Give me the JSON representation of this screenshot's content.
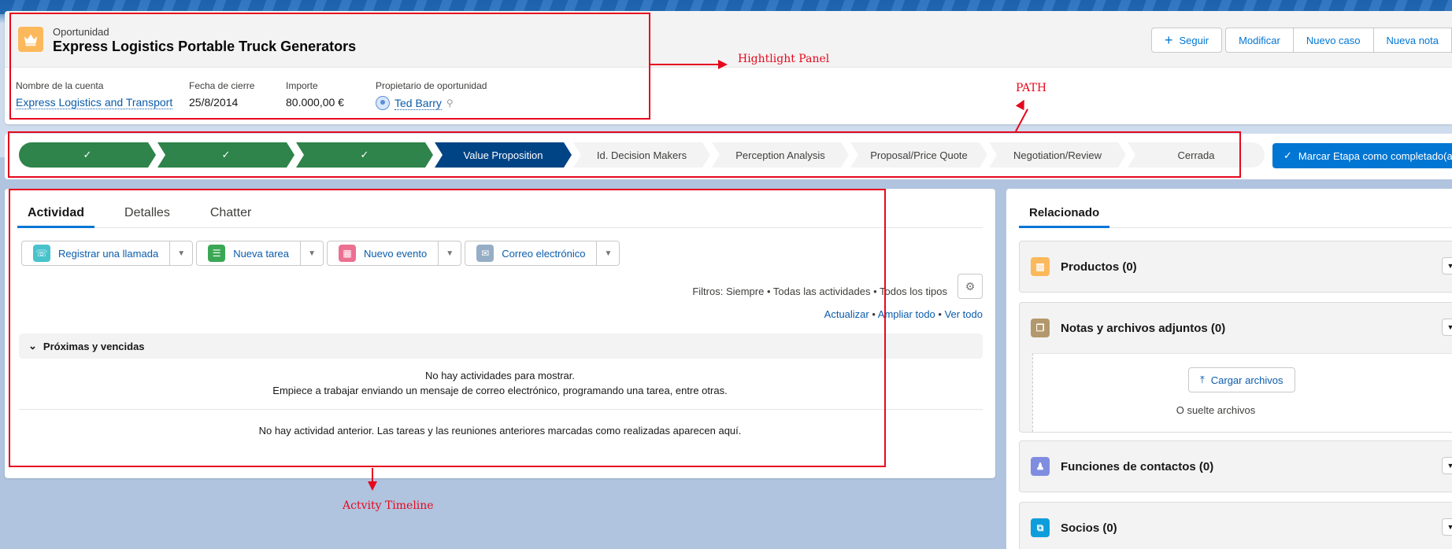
{
  "highlight": {
    "record_type": "Oportunidad",
    "title": "Express Logistics Portable Truck Generators",
    "actions": [
      "Seguir",
      "Modificar",
      "Nuevo caso",
      "Nueva nota"
    ],
    "fields": [
      {
        "label": "Nombre de la cuenta",
        "value": "Express Logistics and Transport"
      },
      {
        "label": "Fecha de cierre",
        "value": "25/8/2014"
      },
      {
        "label": "Importe",
        "value": "80.000,00 €"
      },
      {
        "label": "Propietario de oportunidad",
        "value": "Ted Barry"
      }
    ]
  },
  "path": {
    "stages": [
      "",
      "",
      "",
      "Value Proposition",
      "Id. Decision Makers",
      "Perception Analysis",
      "Proposal/Price Quote",
      "Negotiation/Review",
      "Cerrada"
    ],
    "mark_button": "Marcar Etapa como completado(a)"
  },
  "activity": {
    "tabs": [
      "Actividad",
      "Detalles",
      "Chatter"
    ],
    "publishers": [
      "Registrar una llamada",
      "Nueva tarea",
      "Nuevo evento",
      "Correo electrónico"
    ],
    "filters": "Filtros: Siempre • Todas las actividades • Todos los tipos",
    "links": [
      "Actualizar",
      "Ampliar todo",
      "Ver todo"
    ],
    "section": "Próximas y vencidas",
    "empty_line1": "No hay actividades para mostrar.",
    "empty_line2": "Empiece a trabajar enviando un mensaje de correo electrónico, programando una tarea, entre otras.",
    "empty_past": "No hay actividad anterior. Las tareas y las reuniones anteriores marcadas como realizadas aparecen aquí."
  },
  "related": {
    "tab": "Relacionado",
    "items": [
      {
        "title": "Productos (0)"
      },
      {
        "title": "Notas y archivos adjuntos (0)"
      },
      {
        "title": "Funciones de contactos (0)"
      },
      {
        "title": "Socios (0)"
      }
    ],
    "upload_label": "Cargar archivos",
    "drop_label": "O suelte archivos"
  },
  "annotations": {
    "highlight": "Hightlight Panel",
    "path": "PATH",
    "timeline": "Actvity Timeline"
  },
  "colors": {
    "accent": "#0176d3",
    "path_done": "#2e844a",
    "path_current": "#014486",
    "annotation": "#e5091e"
  }
}
